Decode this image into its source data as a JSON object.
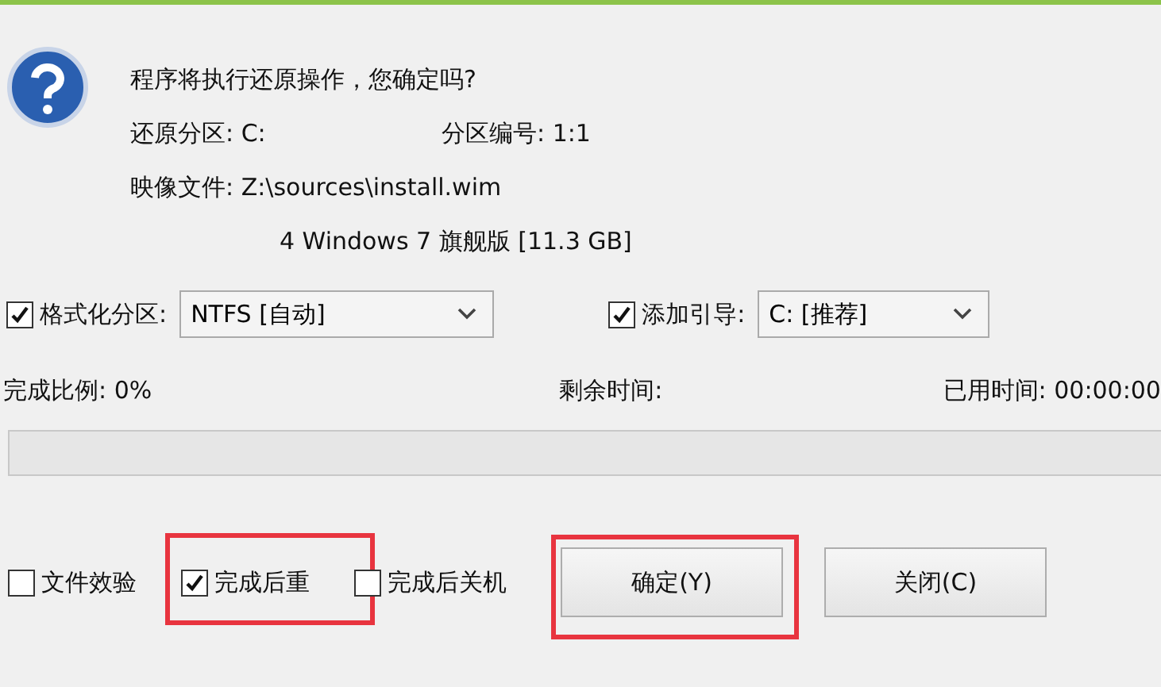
{
  "message": {
    "title": "程序将执行还原操作，您确定吗?",
    "partition": "还原分区: C:",
    "partition_number": "分区编号: 1:1",
    "image_file": "映像文件: Z:\\sources\\install.wim",
    "image_entry": "4 Windows 7 旗舰版 [11.3 GB]"
  },
  "options": [
    {
      "label": "格式化分区:",
      "checked": true,
      "select": "NTFS [自动]"
    },
    {
      "label": "添加引导:",
      "checked": true,
      "select": "C: [推荐]"
    }
  ],
  "progress": {
    "percent": "完成比例: 0%",
    "remaining": "剩余时间:",
    "elapsed": "已用时间: 00:00:00"
  },
  "after_options": [
    {
      "label": "文件效验",
      "checked": false,
      "highlighted": false
    },
    {
      "label": "完成后重",
      "checked": true,
      "highlighted": true
    },
    {
      "label": "完成后关机",
      "checked": false,
      "highlighted": false
    }
  ],
  "buttons": [
    {
      "label": "确定(Y)",
      "highlighted": true
    },
    {
      "label": "关闭(C)",
      "highlighted": false
    }
  ]
}
